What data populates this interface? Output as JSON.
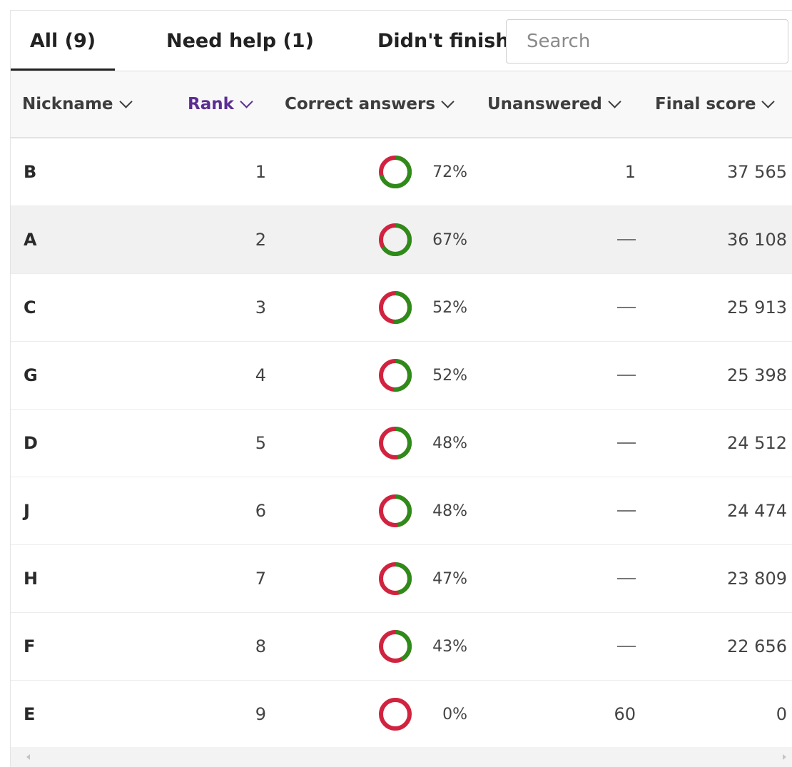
{
  "tabs": {
    "all": "All (9)",
    "need_help": "Need help (1)",
    "didnt_finish": "Didn't finish"
  },
  "search": {
    "placeholder": "Search"
  },
  "columns": {
    "nickname": "Nickname",
    "rank": "Rank",
    "correct_answers": "Correct answers",
    "unanswered": "Unanswered",
    "final_score": "Final score"
  },
  "colors": {
    "correct": "#2e8b1a",
    "incorrect": "#d1233f",
    "sorted_header": "#5c2d91"
  },
  "rows": [
    {
      "nickname": "B",
      "rank": "1",
      "correct_pct": "72%",
      "correct_fraction": 0.72,
      "unanswered": "1",
      "unanswered_fraction": 0.02,
      "final_score": "37 565"
    },
    {
      "nickname": "A",
      "rank": "2",
      "correct_pct": "67%",
      "correct_fraction": 0.67,
      "unanswered": "—",
      "unanswered_fraction": 0,
      "final_score": "36 108"
    },
    {
      "nickname": "C",
      "rank": "3",
      "correct_pct": "52%",
      "correct_fraction": 0.52,
      "unanswered": "—",
      "unanswered_fraction": 0,
      "final_score": "25 913"
    },
    {
      "nickname": "G",
      "rank": "4",
      "correct_pct": "52%",
      "correct_fraction": 0.52,
      "unanswered": "—",
      "unanswered_fraction": 0,
      "final_score": "25 398"
    },
    {
      "nickname": "D",
      "rank": "5",
      "correct_pct": "48%",
      "correct_fraction": 0.48,
      "unanswered": "—",
      "unanswered_fraction": 0,
      "final_score": "24 512"
    },
    {
      "nickname": "J",
      "rank": "6",
      "correct_pct": "48%",
      "correct_fraction": 0.48,
      "unanswered": "—",
      "unanswered_fraction": 0,
      "final_score": "24 474"
    },
    {
      "nickname": "H",
      "rank": "7",
      "correct_pct": "47%",
      "correct_fraction": 0.47,
      "unanswered": "—",
      "unanswered_fraction": 0,
      "final_score": "23 809"
    },
    {
      "nickname": "F",
      "rank": "8",
      "correct_pct": "43%",
      "correct_fraction": 0.43,
      "unanswered": "—",
      "unanswered_fraction": 0,
      "final_score": "22 656"
    },
    {
      "nickname": "E",
      "rank": "9",
      "correct_pct": "0%",
      "correct_fraction": 0,
      "unanswered": "60",
      "unanswered_fraction": 1,
      "final_score": "0"
    }
  ]
}
